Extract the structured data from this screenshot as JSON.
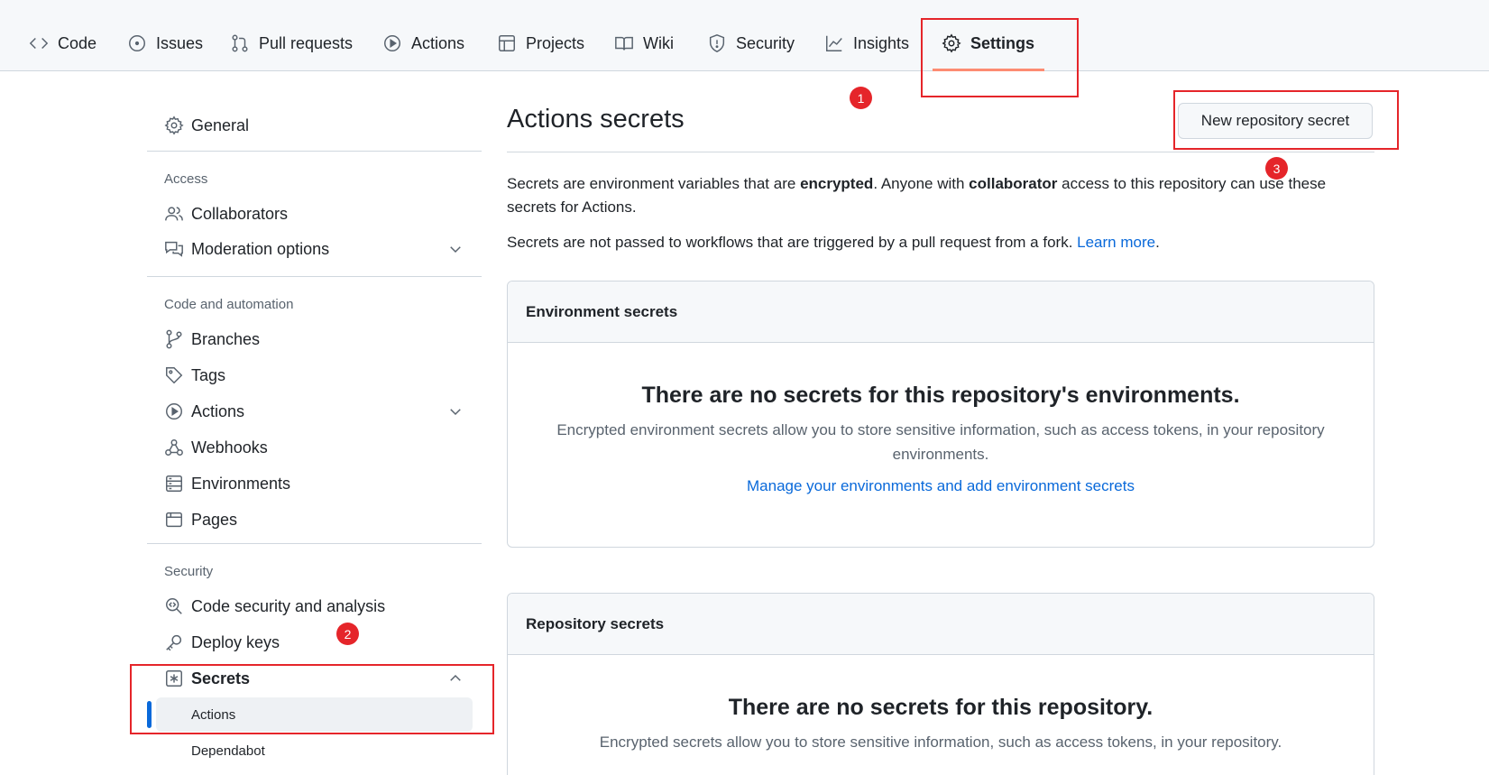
{
  "topnav": {
    "tabs": [
      {
        "label": "Code",
        "icon": "code-icon"
      },
      {
        "label": "Issues",
        "icon": "issue-icon"
      },
      {
        "label": "Pull requests",
        "icon": "pull-request-icon"
      },
      {
        "label": "Actions",
        "icon": "play-icon"
      },
      {
        "label": "Projects",
        "icon": "table-icon"
      },
      {
        "label": "Wiki",
        "icon": "book-icon"
      },
      {
        "label": "Security",
        "icon": "shield-icon"
      },
      {
        "label": "Insights",
        "icon": "graph-icon"
      },
      {
        "label": "Settings",
        "icon": "gear-icon"
      }
    ],
    "active_tab": "Settings",
    "active_color": "#fd8c73"
  },
  "annotations": {
    "badge1": "1",
    "badge2": "2",
    "badge3": "3",
    "color": "#e5252a"
  },
  "sidebar": {
    "general": "General",
    "access_heading": "Access",
    "collaborators": "Collaborators",
    "moderation": "Moderation options",
    "code_heading": "Code and automation",
    "branches": "Branches",
    "tags": "Tags",
    "actions": "Actions",
    "webhooks": "Webhooks",
    "environments": "Environments",
    "pages": "Pages",
    "security_heading": "Security",
    "code_security": "Code security and analysis",
    "deploy_keys": "Deploy keys",
    "secrets": "Secrets",
    "secrets_actions": "Actions",
    "secrets_dependabot": "Dependabot",
    "active_indicator_color": "#0969da"
  },
  "main": {
    "title": "Actions secrets",
    "new_button": "New repository secret",
    "intro_1a": "Secrets are environment variables that are ",
    "intro_1b": "encrypted",
    "intro_1c": ". Anyone with ",
    "intro_1d": "collaborator",
    "intro_1e": " access to this repository can use these secrets for Actions.",
    "intro_2": "Secrets are not passed to workflows that are triggered by a pull request from a fork. ",
    "learn_more": "Learn more",
    "learn_more_suffix": ".",
    "env_box": {
      "header": "Environment secrets",
      "title": "There are no secrets for this repository's environments.",
      "desc": "Encrypted environment secrets allow you to store sensitive information, such as access tokens, in your repository environments.",
      "link": "Manage your environments and add environment secrets"
    },
    "repo_box": {
      "header": "Repository secrets",
      "title": "There are no secrets for this repository.",
      "desc": "Encrypted secrets allow you to store sensitive information, such as access tokens, in your repository."
    }
  }
}
